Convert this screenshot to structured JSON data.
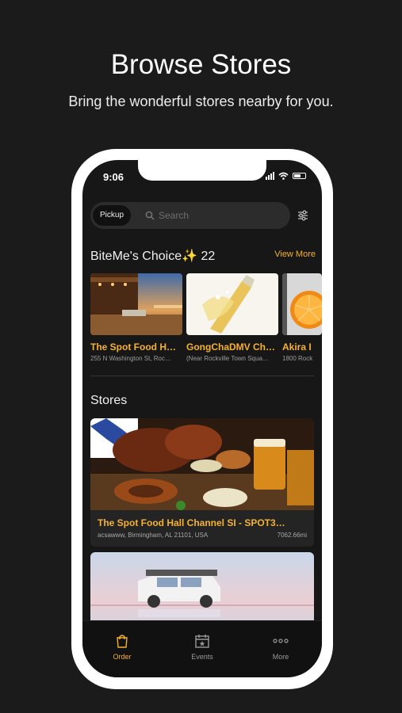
{
  "header": {
    "title": "Browse Stores",
    "subtitle": "Bring the wonderful stores nearby for you."
  },
  "status_bar": {
    "time": "9:06"
  },
  "search": {
    "mode_button": "Pickup",
    "placeholder": "Search"
  },
  "choice_section": {
    "title": "BiteMe's Choice✨ 22",
    "view_more": "View More",
    "items": [
      {
        "name": "The Spot Food H…",
        "address": "255 N Washington St, Roc…"
      },
      {
        "name": "GongChaDMV Ch…",
        "address": "(Near Rockville Town Squa…"
      },
      {
        "name": "Akira I",
        "address": "1800 Rock"
      }
    ]
  },
  "stores_section": {
    "title": "Stores",
    "items": [
      {
        "name": "The Spot Food Hall Channel SI - SPOT3…",
        "address": "acsawww, Birmingham, AL 21101, USA",
        "distance": "7062.66mi"
      }
    ]
  },
  "tab_bar": {
    "tabs": [
      {
        "label": "Order",
        "icon": "bag-icon",
        "active": true
      },
      {
        "label": "Events",
        "icon": "calendar-icon",
        "active": false
      },
      {
        "label": "More",
        "icon": "more-dots-icon",
        "active": false
      }
    ]
  },
  "colors": {
    "accent": "#f5b130",
    "background": "#1b1b1b",
    "screen": "#171717"
  }
}
